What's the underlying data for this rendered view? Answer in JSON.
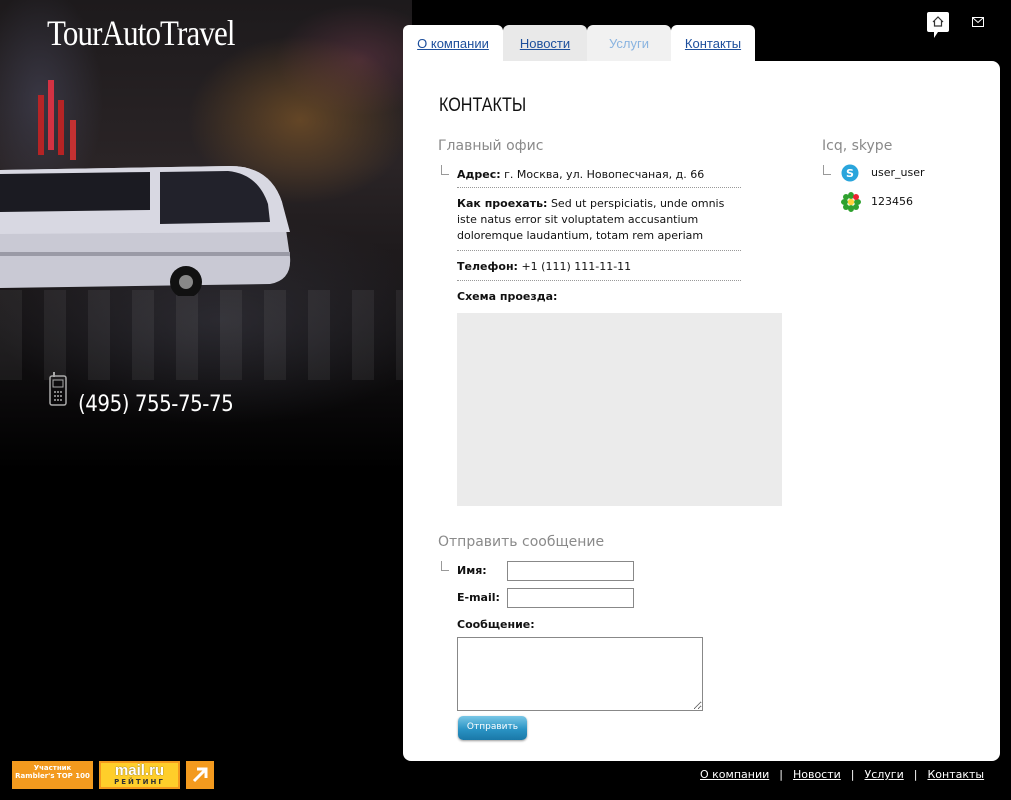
{
  "site": {
    "logo": "TourAutoTravel",
    "phone": "(495) 755-75-75"
  },
  "tabs": [
    {
      "label": "О компании",
      "active": false
    },
    {
      "label": "Новости",
      "active": false
    },
    {
      "label": "Услуги",
      "active": true
    },
    {
      "label": "Контакты",
      "active": false
    }
  ],
  "page": {
    "title": "КОНТАКТЫ"
  },
  "office": {
    "title": "Главный офис",
    "address_label": "Адрес:",
    "address_value": "г. Москва, ул. Новопесчаная, д. 66",
    "directions_label": "Как проехать:",
    "directions_value": "Sed ut perspiciatis, unde omnis iste natus error sit voluptatem accusantium doloremque laudantium, totam rem aperiam",
    "phone_label": "Телефон:",
    "phone_value": "+1 (111) 111-11-11",
    "map_label": "Схема проезда:"
  },
  "messengers": {
    "title": "Icq, skype",
    "skype": "user_user",
    "icq": "123456"
  },
  "form": {
    "title": "Отправить сообщение",
    "name_label": "Имя:",
    "email_label": "E-mail:",
    "message_label": "Сообщение:",
    "submit_label": "Отправить"
  },
  "footer": {
    "links": [
      "О компании",
      "Новости",
      "Услуги",
      "Контакты"
    ],
    "rambler_badge": "Участник Rambler's TOP 100",
    "mailru_badge_top": "mail.ru",
    "mailru_badge_bottom": "РЕЙТИНГ"
  },
  "colors": {
    "link": "#1d4f9c",
    "active_tab": "#8ab4e0",
    "button": "#2a93c4"
  }
}
